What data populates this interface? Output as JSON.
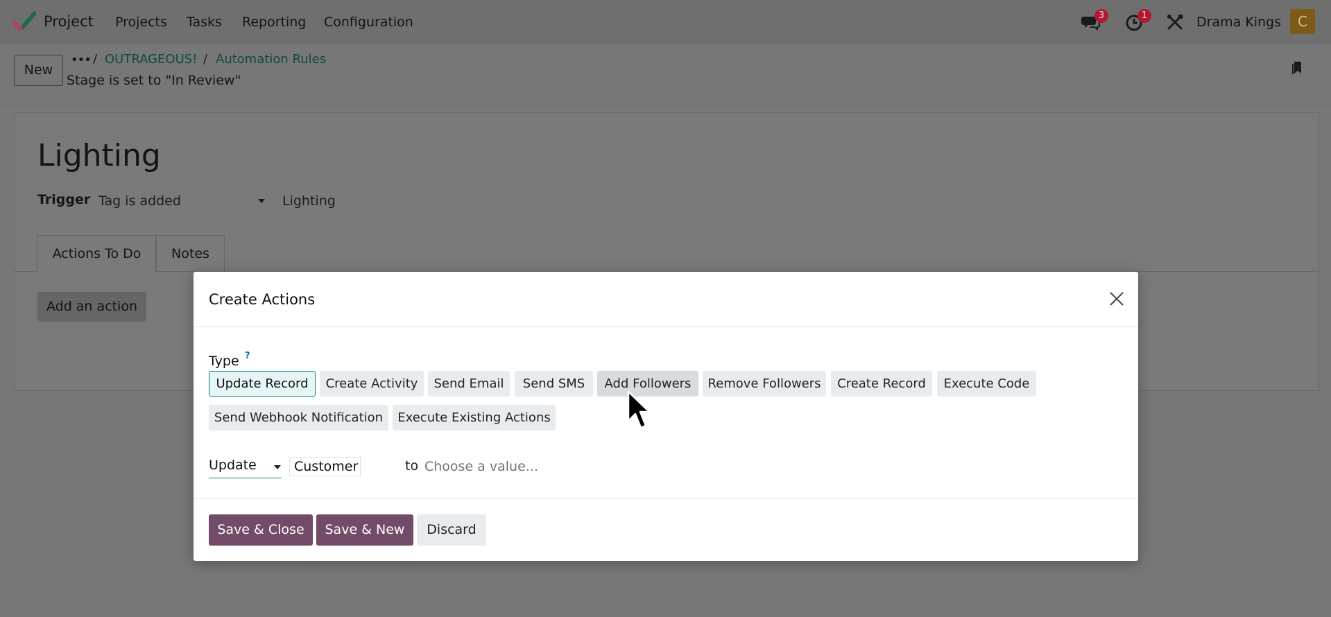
{
  "topbar": {
    "app_name": "Project",
    "menu": [
      "Projects",
      "Tasks",
      "Reporting",
      "Configuration"
    ],
    "messages_badge": "3",
    "activities_badge": "1",
    "company": "Drama Kings",
    "avatar_letter": "C",
    "icons": [
      "project-logo-icon",
      "chat-icon",
      "clock-icon",
      "tools-icon"
    ]
  },
  "controlbar": {
    "new_label": "New",
    "breadcrumb": [
      "OUTRAGEOUS!",
      "Automation Rules"
    ],
    "breadcrumb_sep": "/",
    "record_name": "Stage is set to \"In Review\"",
    "more_label": "•••"
  },
  "form": {
    "title": "Lighting",
    "trigger_label": "Trigger",
    "trigger_value": "Tag is added",
    "trigger_tag": "Lighting",
    "tabs": [
      "Actions To Do",
      "Notes"
    ],
    "add_action_label": "Add an action"
  },
  "modal": {
    "title": "Create Actions",
    "type_label": "Type",
    "type_help": "?",
    "types": [
      "Update Record",
      "Create Activity",
      "Send Email",
      "Send SMS",
      "Add Followers",
      "Remove Followers",
      "Create Record",
      "Execute Code",
      "Send Webhook Notification",
      "Execute Existing Actions"
    ],
    "selected_type": "Update Record",
    "update_label": "Update",
    "field_value": "Customer",
    "to_label": "to",
    "value_placeholder": "Choose a value...",
    "buttons": {
      "save_close": "Save & Close",
      "save_new": "Save & New",
      "discard": "Discard"
    }
  },
  "colors": {
    "primary": "#714b67",
    "teal": "#017e84",
    "badge": "#b0192f"
  }
}
